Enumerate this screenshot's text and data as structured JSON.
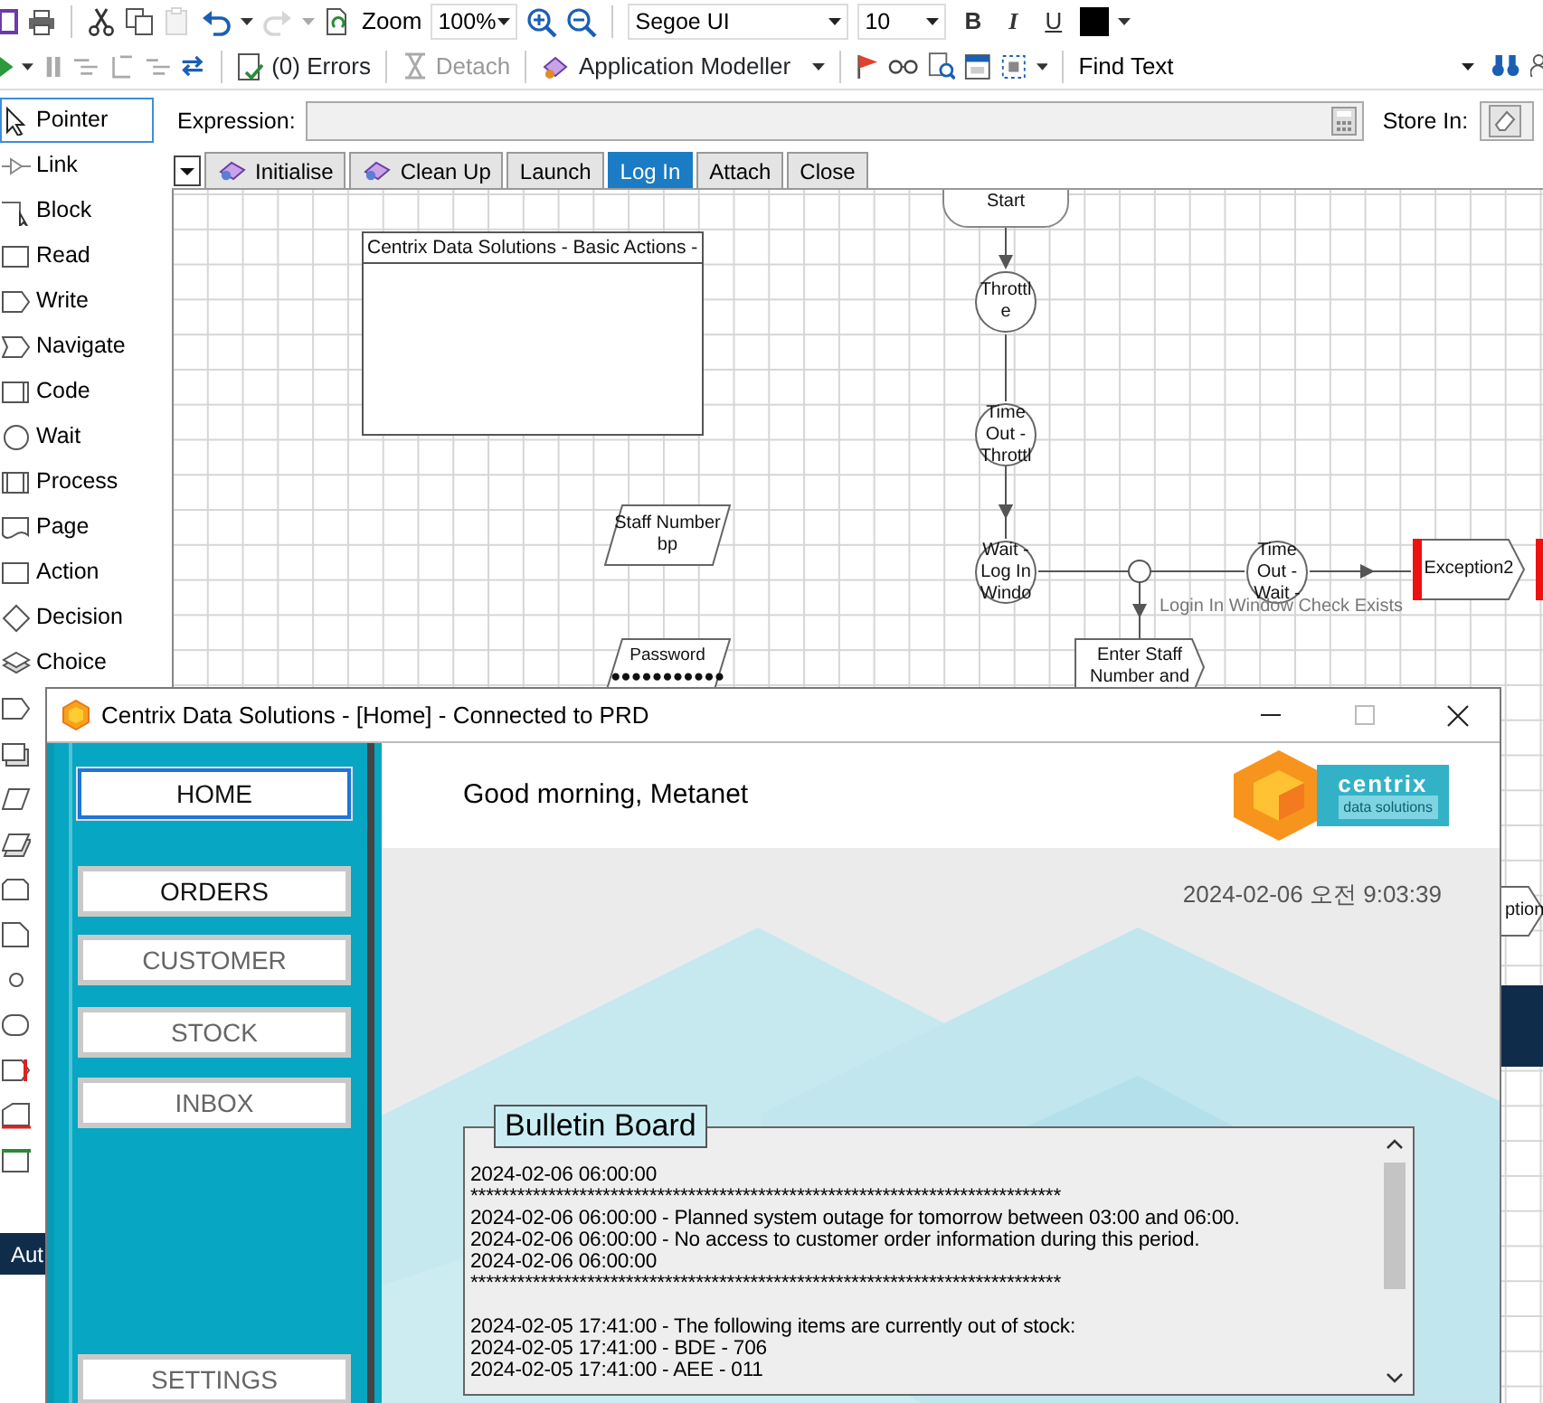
{
  "toolbar": {
    "zoom_label": "Zoom",
    "zoom": "100%",
    "font": "Segoe UI",
    "font_size": "10",
    "bold": "B",
    "italic": "I",
    "underline": "U",
    "paste": {
      "disabled": true
    },
    "redo": {
      "disabled": true
    }
  },
  "debug_toolbar": {
    "errors": "(0) Errors",
    "detach": {
      "label": "Detach",
      "disabled": true
    },
    "modeller": "Application Modeller",
    "find_label": "Find Text"
  },
  "palette": [
    {
      "kind": "pointer",
      "label": "Pointer",
      "selected": true
    },
    {
      "kind": "link",
      "label": "Link",
      "selected": false
    },
    {
      "kind": "block",
      "label": "Block",
      "selected": false
    },
    {
      "kind": "read",
      "label": "Read",
      "selected": false
    },
    {
      "kind": "write",
      "label": "Write",
      "selected": false
    },
    {
      "kind": "navigate",
      "label": "Navigate",
      "selected": false
    },
    {
      "kind": "code",
      "label": "Code",
      "selected": false
    },
    {
      "kind": "wait",
      "label": "Wait",
      "selected": false
    },
    {
      "kind": "process",
      "label": "Process",
      "selected": false
    },
    {
      "kind": "page",
      "label": "Page",
      "selected": false
    },
    {
      "kind": "action",
      "label": "Action",
      "selected": false
    },
    {
      "kind": "decision",
      "label": "Decision",
      "selected": false
    },
    {
      "kind": "choice",
      "label": "Choice",
      "selected": false
    },
    {
      "kind": "calculation",
      "selected": false
    },
    {
      "kind": "multi",
      "selected": false
    },
    {
      "kind": "data",
      "selected": false
    },
    {
      "kind": "collection",
      "selected": false
    },
    {
      "kind": "loop",
      "selected": false
    },
    {
      "kind": "note",
      "selected": false
    },
    {
      "kind": "anchor",
      "selected": false
    },
    {
      "kind": "end",
      "selected": false
    },
    {
      "kind": "exception",
      "selected": false
    },
    {
      "kind": "recover",
      "selected": false
    },
    {
      "kind": "resume",
      "selected": false
    }
  ],
  "expression": {
    "label": "Expression:"
  },
  "store_in": {
    "label": "Store In:"
  },
  "page_tabs": [
    {
      "label": "Initialise",
      "icon": true,
      "selected": false
    },
    {
      "label": "Clean Up",
      "icon": true,
      "selected": false
    },
    {
      "label": "Launch",
      "icon": false,
      "selected": false
    },
    {
      "label": "Log In",
      "icon": false,
      "selected": true
    },
    {
      "label": "Attach",
      "icon": false,
      "selected": false
    },
    {
      "label": "Close",
      "icon": false,
      "selected": false
    }
  ],
  "diagram": {
    "nodes": [
      {
        "kind": "block",
        "label": "Centrix Data Solutions - Basic Actions -"
      },
      {
        "kind": "start",
        "label": "Start"
      },
      {
        "kind": "wait",
        "label": "Throttle"
      },
      {
        "kind": "wait",
        "label": "Time Out - Throttl"
      },
      {
        "kind": "wait",
        "label": "Wait - Log In Windo"
      },
      {
        "kind": "wait",
        "label": "Time Out - Wait -"
      },
      {
        "kind": "exception",
        "label": "Exception2"
      },
      {
        "kind": "navigate",
        "label": "Enter Staff Number and"
      },
      {
        "kind": "data",
        "label": "Staff Number",
        "value": "bp"
      },
      {
        "kind": "data",
        "label": "Password",
        "value": "●●●●●●●●●●●"
      },
      {
        "kind": "exception",
        "label": "ption"
      },
      {
        "kind": "exception"
      }
    ],
    "link_label": "Login In Window Check Exists"
  },
  "background_task": {
    "label": "Aut"
  },
  "app_window": {
    "title": "Centrix Data Solutions - [Home] - Connected to PRD",
    "nav": [
      {
        "label": "HOME",
        "selected": true,
        "disabled": false
      },
      {
        "label": "ORDERS",
        "selected": false,
        "disabled": false
      },
      {
        "label": "CUSTOMER",
        "selected": false,
        "disabled": true
      },
      {
        "label": "STOCK",
        "selected": false,
        "disabled": true
      },
      {
        "label": "INBOX",
        "selected": false,
        "disabled": true
      },
      {
        "label": "SETTINGS",
        "selected": false,
        "disabled": true
      }
    ],
    "greeting": "Good morning, Metanet",
    "logo": {
      "name": "centrix",
      "tagline": "data solutions"
    },
    "datetime": "2024-02-06 오전 9:03:39",
    "bulletin": {
      "title": "Bulletin Board",
      "groups": [
        [
          "2024-02-06 06:00:00",
          "****************************************************************************",
          "2024-02-06 06:00:00 - Planned system outage for tomorrow between 03:00 and 06:00.",
          "2024-02-06 06:00:00 - No access to customer order information during this period.",
          "2024-02-06 06:00:00",
          "****************************************************************************"
        ],
        [
          "2024-02-05 17:41:00 - The following items are currently out of stock:",
          "2024-02-05 17:41:00 - BDE - 706",
          "2024-02-05 17:41:00 - AEE - 011"
        ]
      ]
    }
  }
}
